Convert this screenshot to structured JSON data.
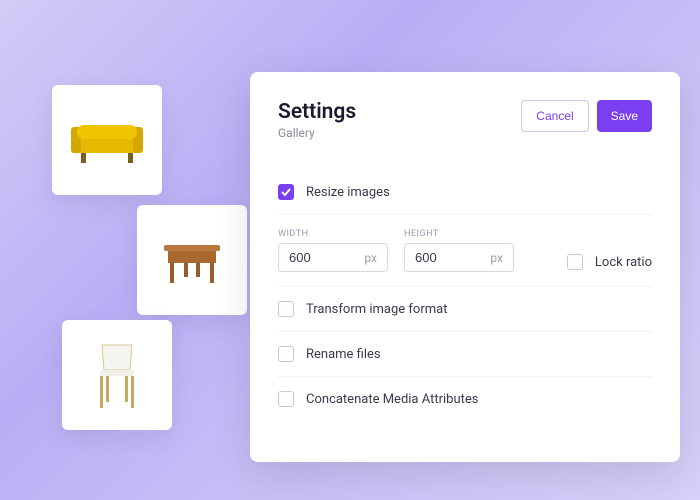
{
  "panel": {
    "title": "Settings",
    "subtitle": "Gallery",
    "cancel_label": "Cancel",
    "save_label": "Save"
  },
  "options": {
    "resize_images": {
      "label": "Resize images",
      "checked": true
    },
    "transform_format": {
      "label": "Transform image format",
      "checked": false
    },
    "rename_files": {
      "label": "Rename files",
      "checked": false
    },
    "concatenate_attrs": {
      "label": "Concatenate Media Attributes",
      "checked": false
    },
    "lock_ratio": {
      "label": "Lock ratio",
      "checked": false
    }
  },
  "dimensions": {
    "width": {
      "label": "WIDTH",
      "value": "600",
      "unit": "px"
    },
    "height": {
      "label": "HEIGHT",
      "value": "600",
      "unit": "px"
    }
  },
  "gallery": {
    "thumbs": [
      "sofa",
      "table",
      "chair"
    ]
  },
  "colors": {
    "accent": "#7b3ff2"
  }
}
